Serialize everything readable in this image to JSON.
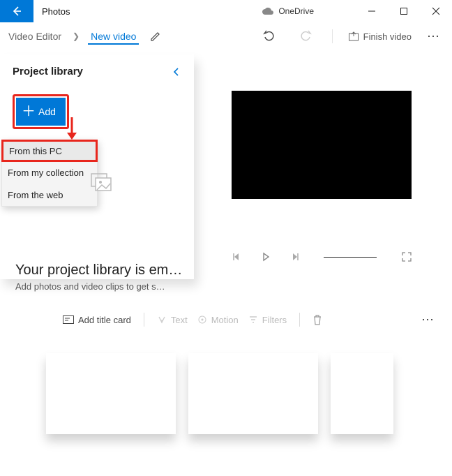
{
  "titlebar": {
    "app_name": "Photos",
    "onedrive_label": "OneDrive"
  },
  "breadcrumb": {
    "root": "Video Editor",
    "current": "New video"
  },
  "toolbar": {
    "finish_label": "Finish video"
  },
  "library": {
    "title": "Project library",
    "add_label": "Add",
    "empty_heading": "Your project library is em…",
    "empty_sub": "Add photos and video clips to get s…"
  },
  "add_menu": {
    "from_pc": "From this PC",
    "from_collection": "From my collection",
    "from_web": "From the web"
  },
  "timeline": {
    "add_title_card": "Add title card",
    "text": "Text",
    "motion": "Motion",
    "filters": "Filters"
  }
}
